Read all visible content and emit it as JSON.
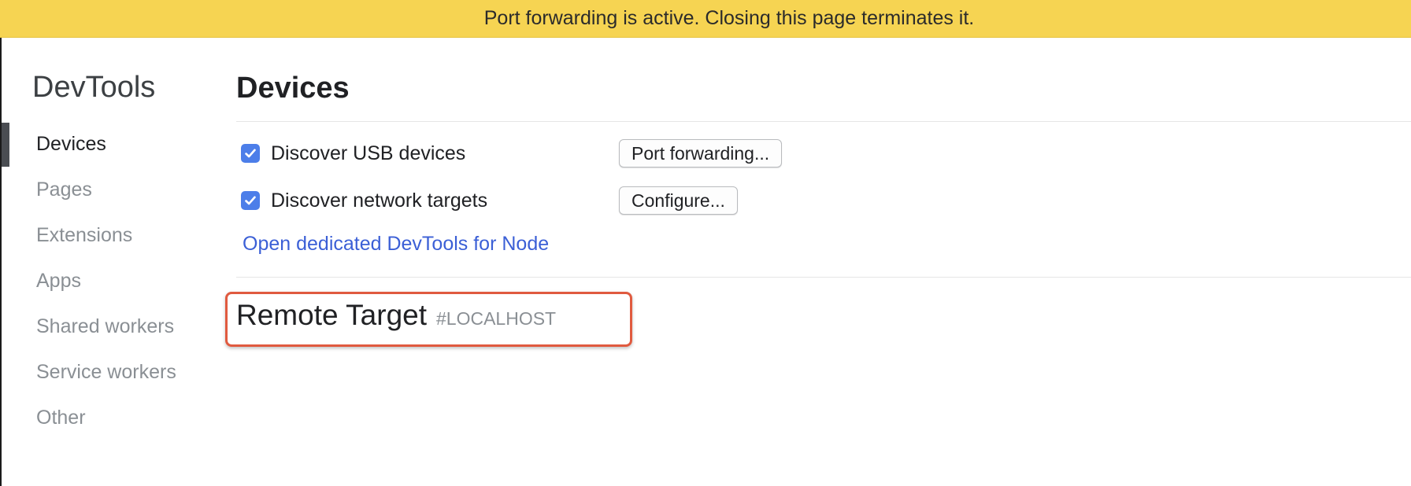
{
  "banner": {
    "message": "Port forwarding is active. Closing this page terminates it.",
    "color": "#f6d452"
  },
  "sidebar": {
    "title": "DevTools",
    "items": [
      {
        "label": "Devices",
        "active": true
      },
      {
        "label": "Pages",
        "active": false
      },
      {
        "label": "Extensions",
        "active": false
      },
      {
        "label": "Apps",
        "active": false
      },
      {
        "label": "Shared workers",
        "active": false
      },
      {
        "label": "Service workers",
        "active": false
      },
      {
        "label": "Other",
        "active": false
      }
    ]
  },
  "main": {
    "title": "Devices",
    "discover_usb": {
      "label": "Discover USB devices",
      "checked": true,
      "button": "Port forwarding..."
    },
    "discover_network": {
      "label": "Discover network targets",
      "checked": true,
      "button": "Configure..."
    },
    "node_link": "Open dedicated DevTools for Node",
    "remote_target": {
      "title": "Remote Target",
      "tag": "#LOCALHOST"
    }
  },
  "colors": {
    "checkbox": "#4c7ee9",
    "link": "#3b5fd6",
    "highlight": "#e05a3f"
  }
}
